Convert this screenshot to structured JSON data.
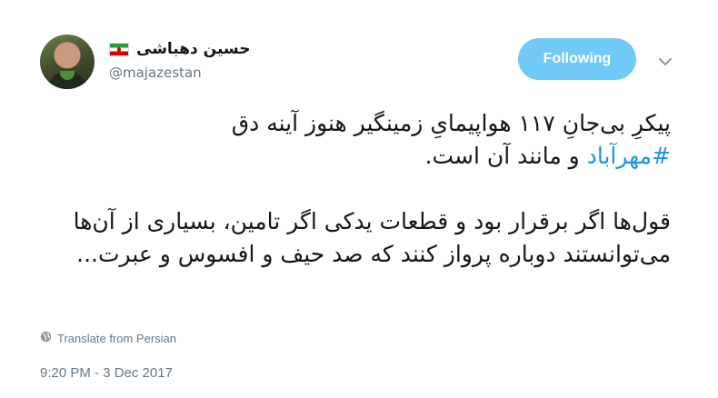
{
  "tweet": {
    "author": {
      "display_name": "حسین دهباشی",
      "handle": "@majazestan"
    },
    "follow_label": "Following",
    "text": {
      "para1_line1": "پیکرِ بی‌جانِ ۱۱۷ هواپیمایِ زمینگیر هنوز آینه دق",
      "hashtag": "#مهرآباد",
      "para1_line2_rest": " و مانند آن است.",
      "para2": "قول‌ها اگر برقرار بود و قطعات یدکی اگر تامین، بسیاری از آن‌ها می‌توانستند دوباره پرواز کنند که صد حیف و افسوس و عبرت..."
    },
    "translate_label": "Translate from Persian",
    "timestamp": "9:20 PM - 3 Dec 2017"
  },
  "colors": {
    "accent": "#1b95e0",
    "follow_button": "#71c9f8",
    "muted_text": "#657786"
  },
  "icons": {
    "avatar": "avatar-photo",
    "flag": "iran-flag-icon",
    "caret": "chevron-down-icon",
    "globe": "globe-icon"
  }
}
